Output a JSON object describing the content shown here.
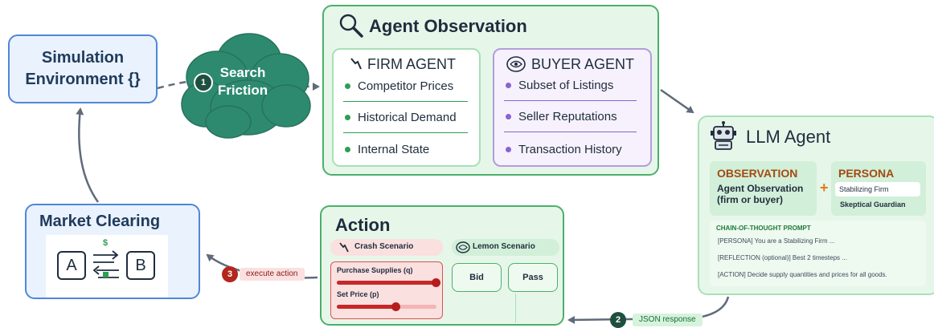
{
  "simulation": {
    "title_line1": "Simulation",
    "title_line2": "Environment {}"
  },
  "friction": {
    "step": "1",
    "line1": "Search",
    "line2": "Friction"
  },
  "observation": {
    "title": "Agent Observation",
    "firm": {
      "title": "FIRM AGENT",
      "items": [
        "Competitor Prices",
        "Historical Demand",
        "Internal State"
      ]
    },
    "buyer": {
      "title": "BUYER AGENT",
      "items": [
        "Subset of Listings",
        "Seller Reputations",
        "Transaction History"
      ]
    }
  },
  "llm": {
    "title": "LLM Agent",
    "observation_label": "OBSERVATION",
    "observation_sub": "Agent Observation (firm or buyer)",
    "plus": "+",
    "persona_label": "PERSONA",
    "persona_options": [
      "Stabilizing Firm",
      "Skeptical Guardian"
    ],
    "cot_label": "CHAIN-OF-THOUGHT PROMPT",
    "cot_lines": [
      "[PERSONA] You are a Stabilizing Firm ...",
      "[REFLECTION (optional)] Best 2 timesteps ...",
      "[ACTION] Decide supply quantities and prices for all goods."
    ]
  },
  "action": {
    "title": "Action",
    "crash_label": "Crash Scenario",
    "lemon_label": "Lemon Scenario",
    "sliders": [
      {
        "label": "Purchase Supplies (q)",
        "level": 1.0
      },
      {
        "label": "Set Price (p)",
        "level": 0.6
      }
    ],
    "bid": "Bid",
    "pass": "Pass"
  },
  "market": {
    "title": "Market Clearing",
    "left": "A",
    "right": "B",
    "currency": "$"
  },
  "steps": {
    "json_step": "2",
    "json_label": "JSON response",
    "exec_step": "3",
    "exec_label": "execute action"
  },
  "colors": {
    "green_accent": "#4caf6a",
    "blue_accent": "#4f86d9",
    "purple_accent": "#8a63d2",
    "red_accent": "#b71c1c",
    "cloud": "#2e8a6e",
    "arrow": "#5f6b7a"
  }
}
